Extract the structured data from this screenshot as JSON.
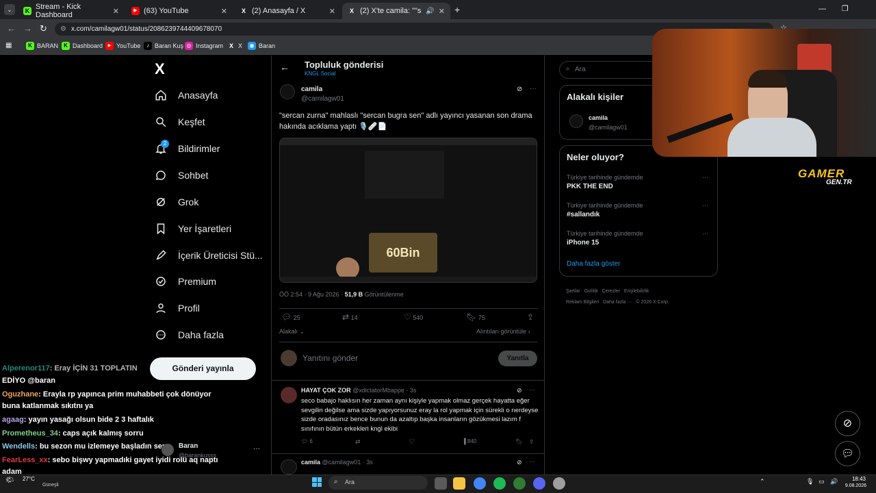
{
  "browser": {
    "tabs": [
      {
        "label": "Stream - Kick Dashboard",
        "favicon": "K"
      },
      {
        "label": "(63) YouTube",
        "favicon": "▶"
      },
      {
        "label": "(2) Anasayfa / X",
        "favicon": "X"
      },
      {
        "label": "(2) X'te camila: \"\"sercan zu",
        "favicon": "X"
      }
    ],
    "url": "x.com/camilagw01/status/2086239744409678070",
    "bookmarks": [
      "BARAN",
      "Dashboard",
      "YouTube",
      "Baran Kuş",
      "Instagram",
      "X",
      "Baran"
    ]
  },
  "sidebar": {
    "logo": "X",
    "items": [
      {
        "label": "Anasayfa",
        "icon": "home-icon"
      },
      {
        "label": "Keşfet",
        "icon": "search-icon"
      },
      {
        "label": "Bildirimler",
        "icon": "bell-icon",
        "badge": "2"
      },
      {
        "label": "Sohbet",
        "icon": "chat-icon"
      },
      {
        "label": "Grok",
        "icon": "grok-icon"
      },
      {
        "label": "Yer İşaretleri",
        "icon": "bookmark-icon"
      },
      {
        "label": "İçerik Üreticisi Stü...",
        "icon": "rocket-icon"
      },
      {
        "label": "Premium",
        "icon": "verified-icon"
      },
      {
        "label": "Profil",
        "icon": "person-icon"
      },
      {
        "label": "Daha fazla",
        "icon": "more-circle-icon"
      }
    ],
    "post_button": "Gönderi yayınla",
    "account_name": "Baran",
    "account_handle": "@barankusss"
  },
  "post": {
    "header_title": "Topluluk gönderisi",
    "header_sub": "KNGL Social",
    "author_name": "camila",
    "author_handle": "@camilagw01",
    "text": "\"sercan zurna\" mahlaslı \"sercan bugra sen\" adlı yayıncı yasanan son drama hakında acıklama yaptı 🎙️🩹📄",
    "media_overlay": "60Bin",
    "timestamp": "ÖÖ 2:54 · 9 Ağu 2026 · ",
    "views": "51,9 B",
    "views_label": "Görüntülenme",
    "replies": "25",
    "reposts": "14",
    "likes": "540",
    "bookmarks": "75",
    "relevance": "Alakalı",
    "quotes_link": "Alıntıları görüntüle",
    "reply_placeholder": "Yanıtını gönder",
    "reply_button": "Yanıtla"
  },
  "replies": [
    {
      "name": "HAYAT ÇOK ZOR",
      "handle": "@xdictatorMbappe · 3s",
      "text": "seco babajo haklısın her zaman aynı kişiyle yapmak olmaz gerçek hayatta eğer sevgilin değilse ama sizde yapıyorsunuz eray la rol yapmak için sürekli o nerdeyse sizde oradasınız bence bunun da azaltıp başka insanların gözükmesi lazım f sınıfının bütün erkekleri kngl ekibi",
      "replies": "6",
      "views": "840"
    },
    {
      "name": "camila",
      "handle": "@camilagw01 · 3s"
    }
  ],
  "right": {
    "search_placeholder": "Ara",
    "people_title": "Alakalı kişiler",
    "person_name": "camila",
    "person_handle": "@camilagw01",
    "trends_title": "Neler oluyor?",
    "trends": [
      {
        "sub": "Türkiye tarihinde gündemde",
        "title": "PKK THE END"
      },
      {
        "sub": "Türkiye tarihinde gündemde",
        "title": "#sallandık"
      },
      {
        "sub": "Türkiye tarihinde gündemde",
        "title": "iPhone 15"
      }
    ],
    "show_more": "Daha fazla göster",
    "footer": [
      "Şartlar",
      "Gizlilik",
      "Çerezler",
      "Erişilebilirlik",
      "Reklam Bilgileri",
      "Daha fazla ···",
      "© 2026 X Corp."
    ]
  },
  "overlay": {
    "logo_line1": "GAMER",
    "logo_line2": "GEN.TR"
  },
  "chat": [
    {
      "user": "Alperenor117",
      "color": "#2ec4b6",
      "msg": ": Eray İÇİN 31 TOPLATIN"
    },
    {
      "user": "",
      "color": "#fff",
      "msg": "EDİYO @baran"
    },
    {
      "user": "Oguzhane",
      "color": "#f4a259",
      "msg": ": Erayla rp yapınca prim muhabbeti çok dönüyor buna katlanmak sıkıtnı ya"
    },
    {
      "user": "agaag",
      "color": "#b5a1e8",
      "msg": ": yayın yasağı olsun bide 2 3 haftalık"
    },
    {
      "user": "Prometheus_34",
      "color": "#7bd389",
      "msg": ": caps açık kalmış sorru"
    },
    {
      "user": "Wendells",
      "color": "#8ecae6",
      "msg": ": bu sezon mu izlemeye başladın sen"
    },
    {
      "user": "FearLess_xx",
      "color": "#e63946",
      "msg": ": sebo bişwy yapmadıki gayet iyidi rolü aq naptı adam"
    }
  ],
  "taskbar": {
    "weather_temp": "27°C",
    "weather_label": "Güneşli",
    "search": "Ara",
    "time": "18:43",
    "date": "9.08.2026"
  },
  "colors": {
    "accent": "#1d9bf0",
    "bg": "#000000",
    "border": "#2f3336"
  }
}
